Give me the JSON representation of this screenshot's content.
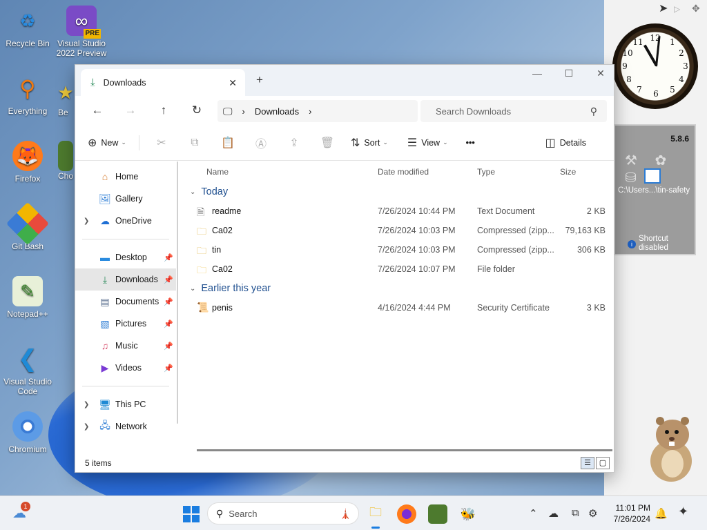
{
  "desktop": {
    "icons": [
      {
        "label": "Recycle Bin",
        "icon": "recycle-bin-icon"
      },
      {
        "label": "Visual Studio 2022 Preview",
        "icon": "visual-studio-icon",
        "badge": "PRE"
      },
      {
        "label": "Everything",
        "icon": "everything-search-icon"
      },
      {
        "label": "Be",
        "icon": "app-icon"
      },
      {
        "label": "Firefox",
        "icon": "firefox-icon"
      },
      {
        "label": "Cho",
        "icon": "app-icon"
      },
      {
        "label": "Git Bash",
        "icon": "git-bash-icon"
      },
      {
        "label": "Notepad++",
        "icon": "notepad-plus-plus-icon"
      },
      {
        "label": "Visual Studio Code",
        "icon": "vscode-icon"
      },
      {
        "label": "Chromium",
        "icon": "chromium-icon"
      }
    ]
  },
  "gadget": {
    "version": "5.8.6",
    "path": "C:\\Users...\\tin-safety",
    "status": "Shortcut disabled"
  },
  "window": {
    "tab_title": "Downloads",
    "path_root": "Downloads",
    "search_placeholder": "Search Downloads",
    "toolbar": {
      "new": "New",
      "sort": "Sort",
      "view": "View",
      "more": "•••",
      "details": "Details"
    },
    "nav": {
      "home": "Home",
      "gallery": "Gallery",
      "onedrive": "OneDrive",
      "desktop": "Desktop",
      "downloads": "Downloads",
      "documents": "Documents",
      "pictures": "Pictures",
      "music": "Music",
      "videos": "Videos",
      "this_pc": "This PC",
      "network": "Network"
    },
    "columns": {
      "name": "Name",
      "date": "Date modified",
      "type": "Type",
      "size": "Size"
    },
    "groups": [
      {
        "label": "Today",
        "files": [
          {
            "name": "readme",
            "date": "7/26/2024 10:44 PM",
            "type": "Text Document",
            "size": "2 KB",
            "icon": "text-file-icon"
          },
          {
            "name": "Ca02",
            "date": "7/26/2024 10:03 PM",
            "type": "Compressed (zipp...",
            "size": "79,163 KB",
            "icon": "zip-folder-icon"
          },
          {
            "name": "tin",
            "date": "7/26/2024 10:03 PM",
            "type": "Compressed (zipp...",
            "size": "306 KB",
            "icon": "zip-folder-icon"
          },
          {
            "name": "Ca02",
            "date": "7/26/2024 10:07 PM",
            "type": "File folder",
            "size": "",
            "icon": "folder-icon"
          }
        ]
      },
      {
        "label": "Earlier this year",
        "files": [
          {
            "name": "penis",
            "date": "4/16/2024 4:44 PM",
            "type": "Security Certificate",
            "size": "3 KB",
            "icon": "certificate-icon"
          }
        ]
      }
    ],
    "status": "5 items"
  },
  "taskbar": {
    "search_placeholder": "Search",
    "time": "11:01 PM",
    "date": "7/26/2024",
    "weather_badge": "1"
  }
}
